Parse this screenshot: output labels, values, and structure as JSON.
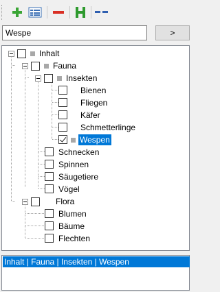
{
  "toolbar": {
    "buttons": [
      {
        "name": "add-icon",
        "color": "#3aa535"
      },
      {
        "name": "list-icon",
        "color": "#3a6fb5"
      },
      {
        "name": "remove-icon",
        "color": "#d93025"
      },
      {
        "name": "h-icon",
        "text": "H",
        "color": "#2e9a2e"
      },
      {
        "name": "dashes-icon",
        "color": "#2f5fb0"
      }
    ]
  },
  "search": {
    "value": "Wespe",
    "button_label": ">"
  },
  "tree": {
    "root": {
      "label": "Inhalt"
    },
    "fauna": {
      "label": "Fauna"
    },
    "insekten": {
      "label": "Insekten"
    },
    "insekten_items": [
      "Bienen",
      "Fliegen",
      "Käfer",
      "Schmetterlinge",
      "Wespen"
    ],
    "fauna_items": [
      "Schnecken",
      "Spinnen",
      "Säugetiere",
      "Vögel"
    ],
    "flora": {
      "label": "Flora"
    },
    "flora_items": [
      "Blumen",
      "Bäume",
      "Flechten"
    ],
    "selected": "Wespen"
  },
  "path_list": {
    "items": [
      "Inhalt | Fauna | Insekten | Wespen"
    ]
  },
  "colors": {
    "selection": "#0078d7"
  }
}
